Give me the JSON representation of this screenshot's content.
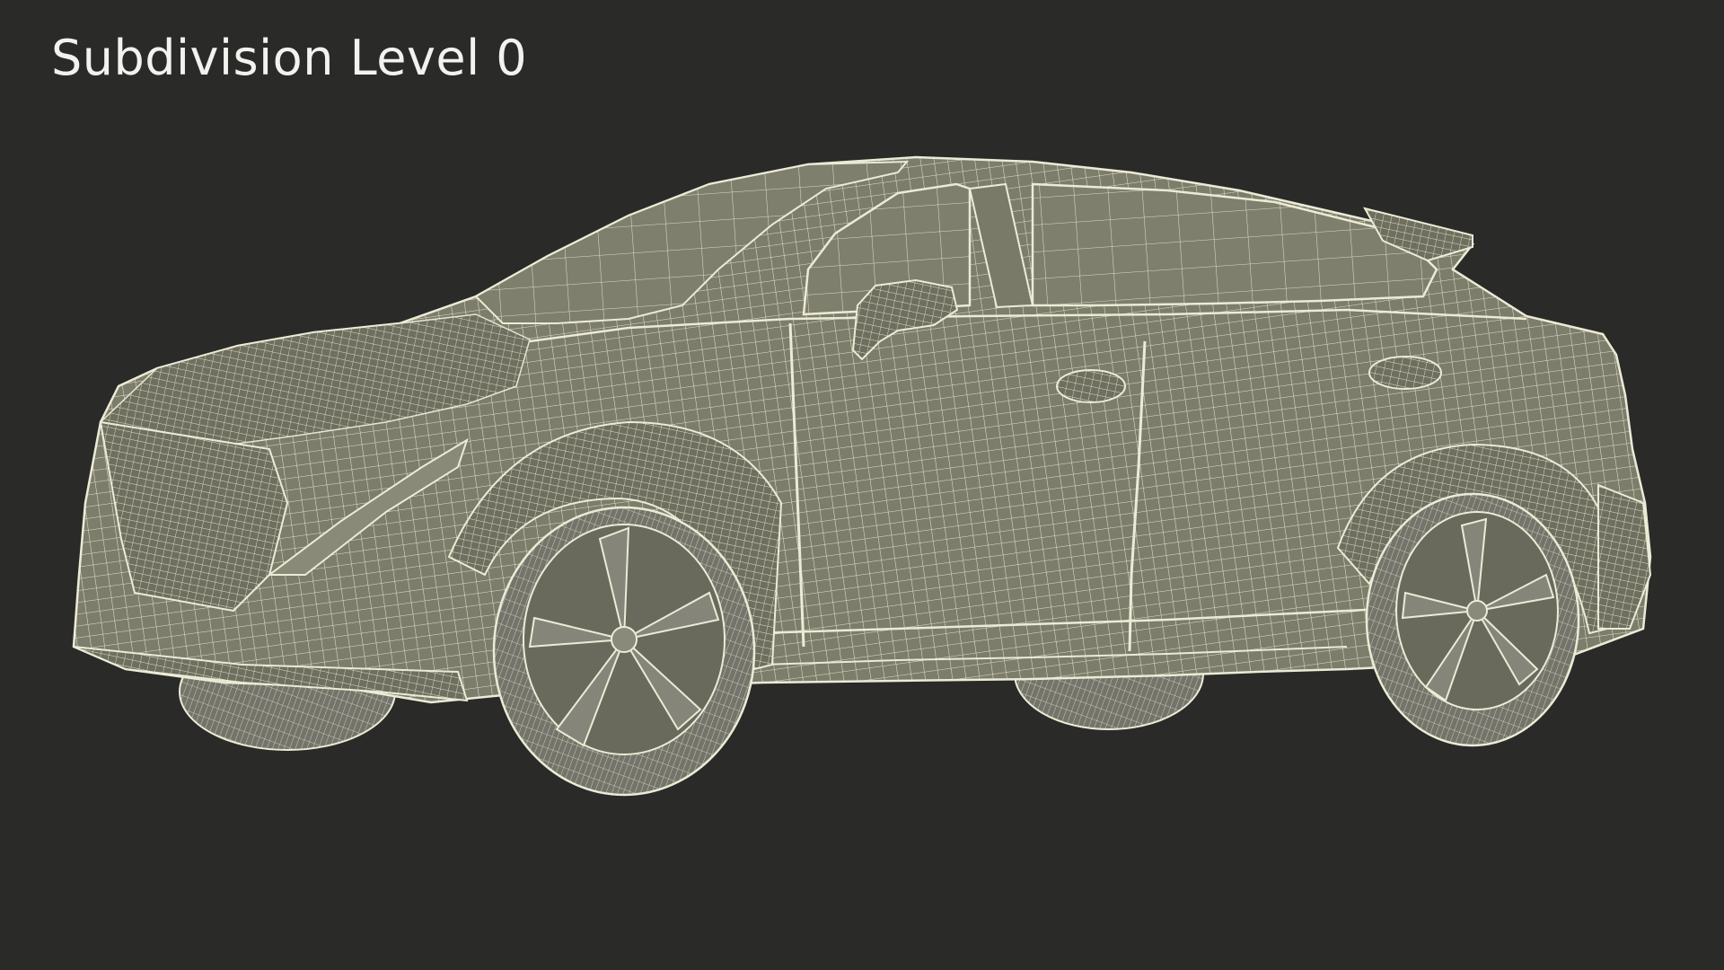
{
  "caption": "Subdivision Level 0",
  "background_color": "#2a2a29",
  "surface_color": "#7d7d6c",
  "wire_color": "#ecebd6",
  "subject": "car-wireframe-render"
}
